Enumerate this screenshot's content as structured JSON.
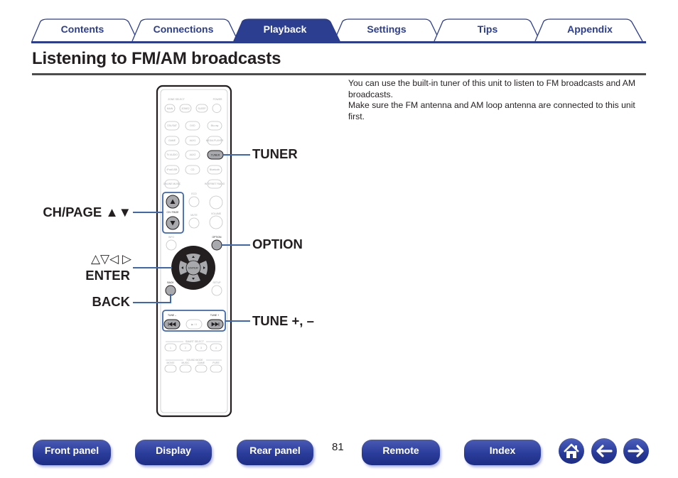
{
  "tabs": [
    {
      "label": "Contents",
      "active": false
    },
    {
      "label": "Connections",
      "active": false
    },
    {
      "label": "Playback",
      "active": true
    },
    {
      "label": "Settings",
      "active": false
    },
    {
      "label": "Tips",
      "active": false
    },
    {
      "label": "Appendix",
      "active": false
    }
  ],
  "colors": {
    "brand_blue": "#2c3e8f",
    "active_tab": "#2c3e8f",
    "leader_blue": "#3d67b1",
    "rule_gray": "#4d4d4f",
    "highlight_button": "#a7a9ac"
  },
  "page": {
    "title": "Listening to FM/AM broadcasts",
    "intro": [
      "You can use the built-in tuner of this unit to listen to FM broadcasts and AM broadcasts.",
      "Make sure the FM antenna and AM loop antenna are connected to this unit first."
    ]
  },
  "callouts": {
    "tuner": "TUNER",
    "ch_page": "CH/PAGE ▲▼",
    "arrows": "△▽◁ ▷",
    "enter": "ENTER",
    "back": "BACK",
    "option": "OPTION",
    "tune": "TUNE +, –"
  },
  "remote": {
    "zone_select": "ZONE SELECT",
    "power": "POWER",
    "zone_buttons": [
      "MAIN",
      "ZONE2",
      "SLEEP"
    ],
    "source_buttons": [
      [
        "CBL/SAT",
        "DVD",
        "Blu-ray"
      ],
      [
        "GAME",
        "AUX1",
        "MEDIA PLAYER"
      ],
      [
        "TV AUDIO",
        "AUX2",
        "TUNER"
      ],
      [
        "iPod/USB",
        "CD",
        "Bluetooth"
      ],
      [
        "ONLINE MUSIC",
        "",
        "INTERNET RADIO"
      ]
    ],
    "eco": "ECO",
    "ch_page": "CH / PAGE",
    "mute": "MUTE",
    "volume": "VOLUME",
    "info": "INFO",
    "option": "OPTION",
    "enter": "ENTER",
    "back": "BACK",
    "setup": "SETUP",
    "tune_minus": "TUNE –",
    "tune_plus": "TUNE +",
    "play_pause": "▶ / II",
    "smart_select": "SMART SELECT",
    "smart_buttons": [
      "1",
      "2",
      "3",
      "4"
    ],
    "sound_mode": "SOUND MODE",
    "sound_buttons": [
      "MOVIE",
      "MUSIC",
      "GAME",
      "PURE"
    ]
  },
  "footer": {
    "buttons": [
      "Front panel",
      "Display",
      "Rear panel",
      "Remote",
      "Index"
    ],
    "page_number": "81",
    "icons": [
      "home-icon",
      "back-arrow-icon",
      "forward-arrow-icon"
    ]
  }
}
